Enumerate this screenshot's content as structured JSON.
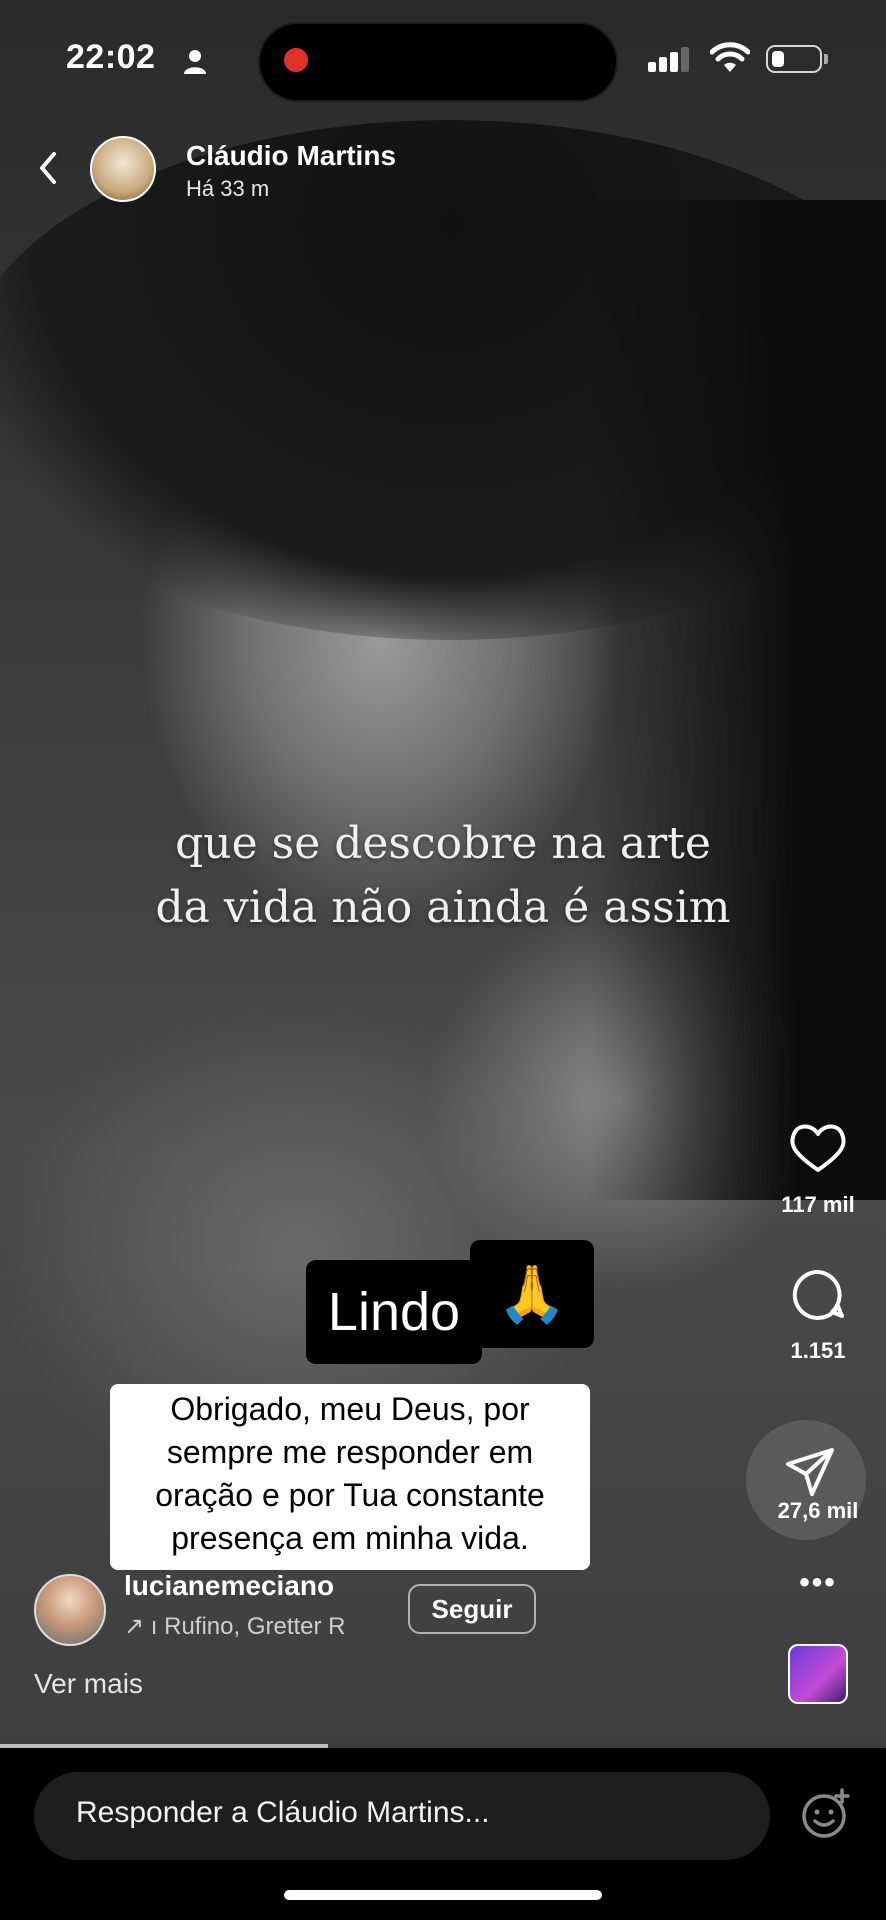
{
  "status_bar": {
    "time": "22:02"
  },
  "header": {
    "author_name": "Cláudio Martins",
    "age": "Há 33 m"
  },
  "video_overlay": {
    "line1": "que se descobre na arte",
    "line2": "da vida não ainda é assim"
  },
  "stickers": {
    "lindo": "Lindo",
    "pray": "🙏"
  },
  "caption": {
    "lines": [
      "Obrigado, meu Deus, por",
      "sempre me responder em",
      "oração e por Tua constante",
      "presença em minha vida."
    ]
  },
  "actions": {
    "likes": "117 mil",
    "comments": "1.151",
    "shares": "27,6 mil",
    "more": "•••"
  },
  "post": {
    "username": "lucianemeciano",
    "audio": "↗ ı Rufino, Gretter R",
    "follow_label": "Seguir",
    "see_more": "Ver mais"
  },
  "progress": {
    "fraction": 0.37
  },
  "reply": {
    "placeholder": "Responder a Cláudio Martins..."
  },
  "icons": [
    "person-icon",
    "signal-icon",
    "wifi-icon",
    "battery-icon",
    "back-icon",
    "heart-icon",
    "comment-icon",
    "share-icon",
    "more-icon",
    "emoji-add-icon"
  ]
}
